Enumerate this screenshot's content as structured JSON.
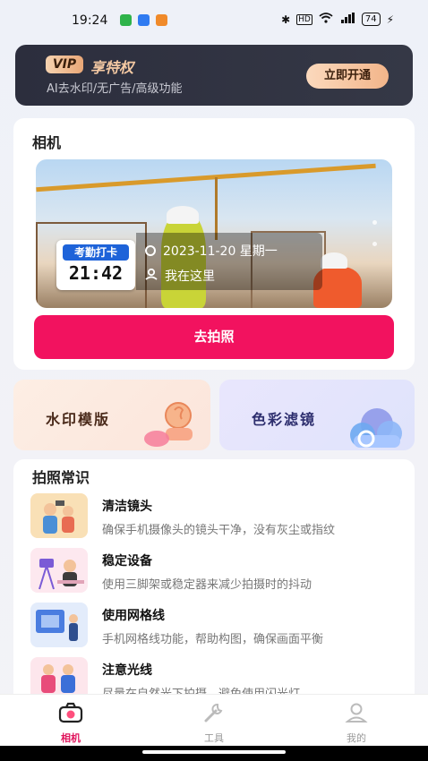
{
  "status_bar": {
    "time": "19:24",
    "app_icon_colors": [
      "#2fb34a",
      "#2f7bf1",
      "#f08a2a"
    ],
    "battery": "74"
  },
  "vip": {
    "badge": "VIP",
    "title": "享特权",
    "subtitle": "AI去水印/无广告/高级功能",
    "button": "立即开通"
  },
  "camera": {
    "title": "相机",
    "watermark": {
      "label": "考勤打卡",
      "time": "21:42",
      "date": "2023-11-20 星期一",
      "location": "我在这里"
    },
    "shoot_button": "去拍照",
    "accent_color": "#f2125f"
  },
  "features": [
    {
      "label": "水印模版",
      "icon": "stamp-icon"
    },
    {
      "label": "色彩滤镜",
      "icon": "cloud-icon"
    }
  ],
  "tips": {
    "title": "拍照常识",
    "items": [
      {
        "title": "清洁镜头",
        "desc": "确保手机摄像头的镜头干净，没有灰尘或指纹"
      },
      {
        "title": "稳定设备",
        "desc": "使用三脚架或稳定器来减少拍摄时的抖动"
      },
      {
        "title": "使用网格线",
        "desc": "手机网格线功能，帮助构图，确保画面平衡"
      },
      {
        "title": "注意光线",
        "desc": "尽量在自然光下拍摄，避免使用闪光灯"
      }
    ]
  },
  "tabbar": {
    "items": [
      {
        "label": "相机",
        "icon": "camera-icon",
        "active": true
      },
      {
        "label": "工具",
        "icon": "wrench-icon",
        "active": false
      },
      {
        "label": "我的",
        "icon": "user-icon",
        "active": false
      }
    ]
  }
}
